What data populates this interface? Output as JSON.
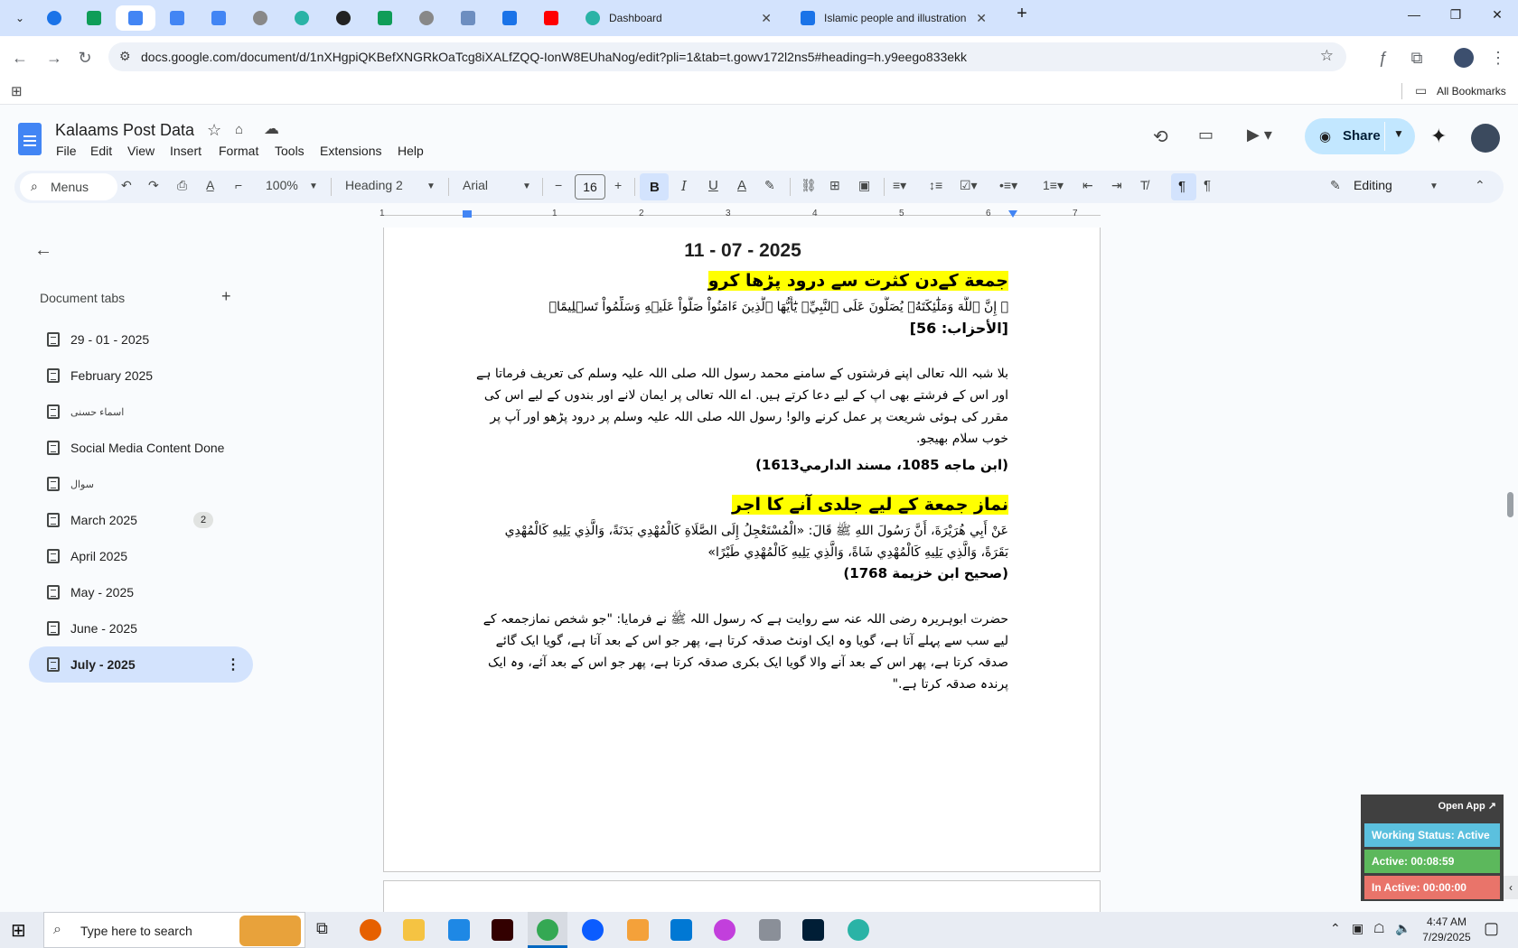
{
  "browser": {
    "active_tab_title": "Dashboard",
    "second_tab_title": "Islamic people and illustration v",
    "url": "docs.google.com/document/d/1nXHgpiQKBefXNGRkOaTcg8iXALfZQQ-IonW8EUhaNog/edit?pli=1&tab=t.gowv172l2ns5#heading=h.y9eego833ekk",
    "bookmarks_label": "All Bookmarks"
  },
  "doc": {
    "title": "Kalaams Post Data",
    "menu": [
      "File",
      "Edit",
      "View",
      "Insert",
      "Format",
      "Tools",
      "Extensions",
      "Help"
    ],
    "share_label": "Share"
  },
  "toolbar": {
    "menus_label": "Menus",
    "zoom": "100%",
    "style": "Heading 2",
    "font": "Arial",
    "font_size": "16",
    "mode": "Editing"
  },
  "ruler": [
    "1",
    "1",
    "2",
    "3",
    "4",
    "5",
    "6",
    "7"
  ],
  "sidebar": {
    "title": "Document tabs",
    "tabs": [
      {
        "label": "29 - 01 - 2025"
      },
      {
        "label": "February 2025"
      },
      {
        "label": "اسماء حسنی"
      },
      {
        "label": "Social Media Content Done"
      },
      {
        "label": "سوال"
      },
      {
        "label": "March 2025",
        "badge": "2"
      },
      {
        "label": "April 2025"
      },
      {
        "label": "May - 2025"
      },
      {
        "label": "June - 2025"
      },
      {
        "label": "July - 2025",
        "selected": true
      }
    ]
  },
  "content": {
    "date": "11 - 07 - 2025",
    "heading1": "جمعة کےدن کثرت سے درود پڑھا کرو",
    "ayah": "﴿ إِنَّ ٱللَّهَ وَمَلَٰٓئِكَتَهُۥ يُصَلُّونَ عَلَى ٱلنَّبِيِّۚ يَٰٓأَيُّهَا ٱلَّذِينَ ءَامَنُواْ صَلُّواْ عَلَيۡهِ وَسَلِّمُواْ تَسۡلِيمًا﴾",
    "ayah_ref": "[الأحزاب: 56]",
    "para1": "بلا شبہ اللہ تعالی اپنے فرشتوں کے سامنے محمد رسول اللہ صلی اللہ علیہ وسلم کی تعریف فرماتا ہے اور اس کے فرشتے بھی اپ کے لیے دعا کرتے ہیں. اے اللہ تعالی پر ایمان لانے اور بندوں کے لیے اس کی مقرر کی ہوئی شریعت پر عمل کرنے والو! رسول اللہ صلی اللہ علیہ وسلم پر درود پڑھو اور آپ پر خوب سلام بھیجو.",
    "para1_ref": "(ابن ماجه 1085، مسند الدارمي1613)",
    "heading2": "نماز جمعة کے لیے جلدی آنے کا اجر",
    "hadith": "عَنْ أَبِي هُرَيْرَةَ، أَنَّ رَسُولَ اللهِ ﷺ قَالَ: «الْمُسْتَعْجِلُ إِلَى الصَّلَاةِ كَالْمُهْدِي بَدَنَةً، وَالَّذِي يَلِيهِ كَالْمُهْدِي بَقَرَةً، وَالَّذِي يَلِيهِ كَالْمُهْدِي شَاةً، وَالَّذِي يَلِيهِ كَالْمُهْدِي طَيْرًا»",
    "hadith_ref": "(صحيح ابن خزيمة 1768)",
    "para2": "حضرت ابوہریرہ رضی اللہ عنہ سے روایت ہے کہ رسول اللہ ﷺ نے فرمایا: \"جو شخص نمازجمعہ کے لیے سب سے پہلے آتا ہے، گویا وہ ایک اونٹ صدقہ کرتا ہے، پھر جو اس کے بعد آتا ہے، گویا ایک گائے صدقہ کرتا ہے، پھر اس کے بعد آنے والا گویا ایک بکری صدقہ کرتا ہے، پھر جو اس کے بعد آئے، وہ ایک پرندہ صدقہ کرتا ہے.\""
  },
  "widget": {
    "open_app": "Open App ↗",
    "working_status": "Working Status: Active",
    "active": "Active: 00:08:59",
    "inactive": "In Active: 00:00:00"
  },
  "taskbar": {
    "search_placeholder": "Type here to search",
    "time": "4:47 AM",
    "date": "7/29/2025"
  },
  "colors": {
    "highlight": "#ffff00",
    "share_bg": "#c2e7ff",
    "selected_tab_bg": "#d3e3fd",
    "working_status": "#5bc0de",
    "active": "#5cb85c",
    "inactive": "#e9746a"
  }
}
